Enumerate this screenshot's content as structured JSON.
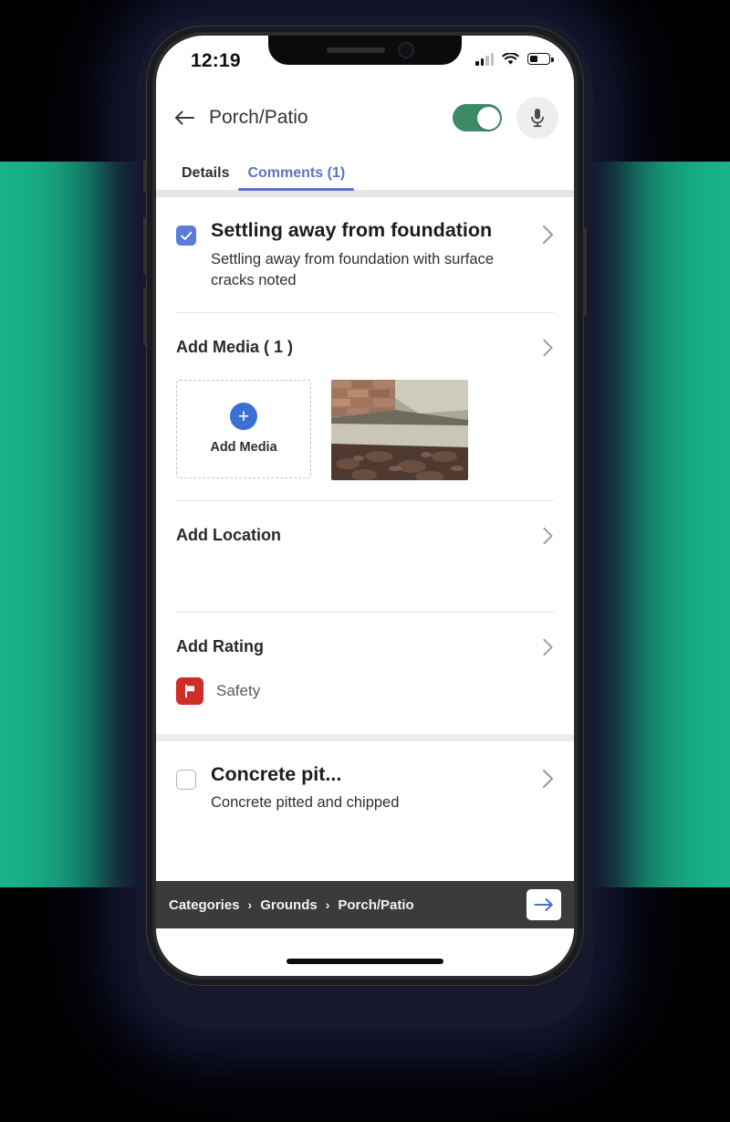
{
  "theme": {
    "background_teal": "#18b48a",
    "background_black": "#000000",
    "accent_blue": "#5b74c4",
    "checkbox_blue": "#5b7cdc",
    "toggle_green": "#3c8a66",
    "safety_red": "#d02d26",
    "breadcrumb_bar": "#3b3b3d"
  },
  "status_bar": {
    "time": "12:19",
    "signal_icon": "cellular-signal-icon",
    "signal_bars_filled": 2,
    "signal_bars_total": 4,
    "wifi_icon": "wifi-icon",
    "battery_icon": "battery-icon",
    "battery_percent": 36
  },
  "header": {
    "back_icon": "back-arrow-icon",
    "title": "Porch/Patio",
    "toggle": {
      "name": "header-toggle",
      "state": "on"
    },
    "mic_icon": "microphone-icon"
  },
  "tabs": [
    {
      "label": "Details",
      "active": false
    },
    {
      "label": "Comments (1)",
      "active": true
    }
  ],
  "items": [
    {
      "checked": true,
      "title": "Settling away from foundation",
      "description": "Settling away from foundation with surface cracks noted",
      "chevron_icon": "chevron-right-icon",
      "sections": [
        {
          "key": "media",
          "title": "Add Media ( 1 )",
          "chevron_icon": "chevron-right-icon"
        },
        {
          "key": "location",
          "title": "Add Location",
          "chevron_icon": "chevron-right-icon"
        },
        {
          "key": "rating",
          "title": "Add Rating",
          "chevron_icon": "chevron-right-icon"
        }
      ],
      "media": {
        "add_button_label": "Add Media",
        "add_icon": "plus-icon",
        "thumbnail_alt": "concrete-slab-photo",
        "count": 1
      },
      "rating": {
        "icon": "safety-flag-icon",
        "label": "Safety"
      }
    },
    {
      "checked": false,
      "title": "Concrete pit...",
      "description": "Concrete pitted and chipped",
      "chevron_icon": "chevron-right-icon"
    }
  ],
  "breadcrumb": {
    "separator": "›",
    "crumbs": [
      "Categories",
      "Grounds",
      "Porch/Patio"
    ],
    "next_button": {
      "name": "next-button",
      "icon": "arrow-right-icon"
    }
  }
}
